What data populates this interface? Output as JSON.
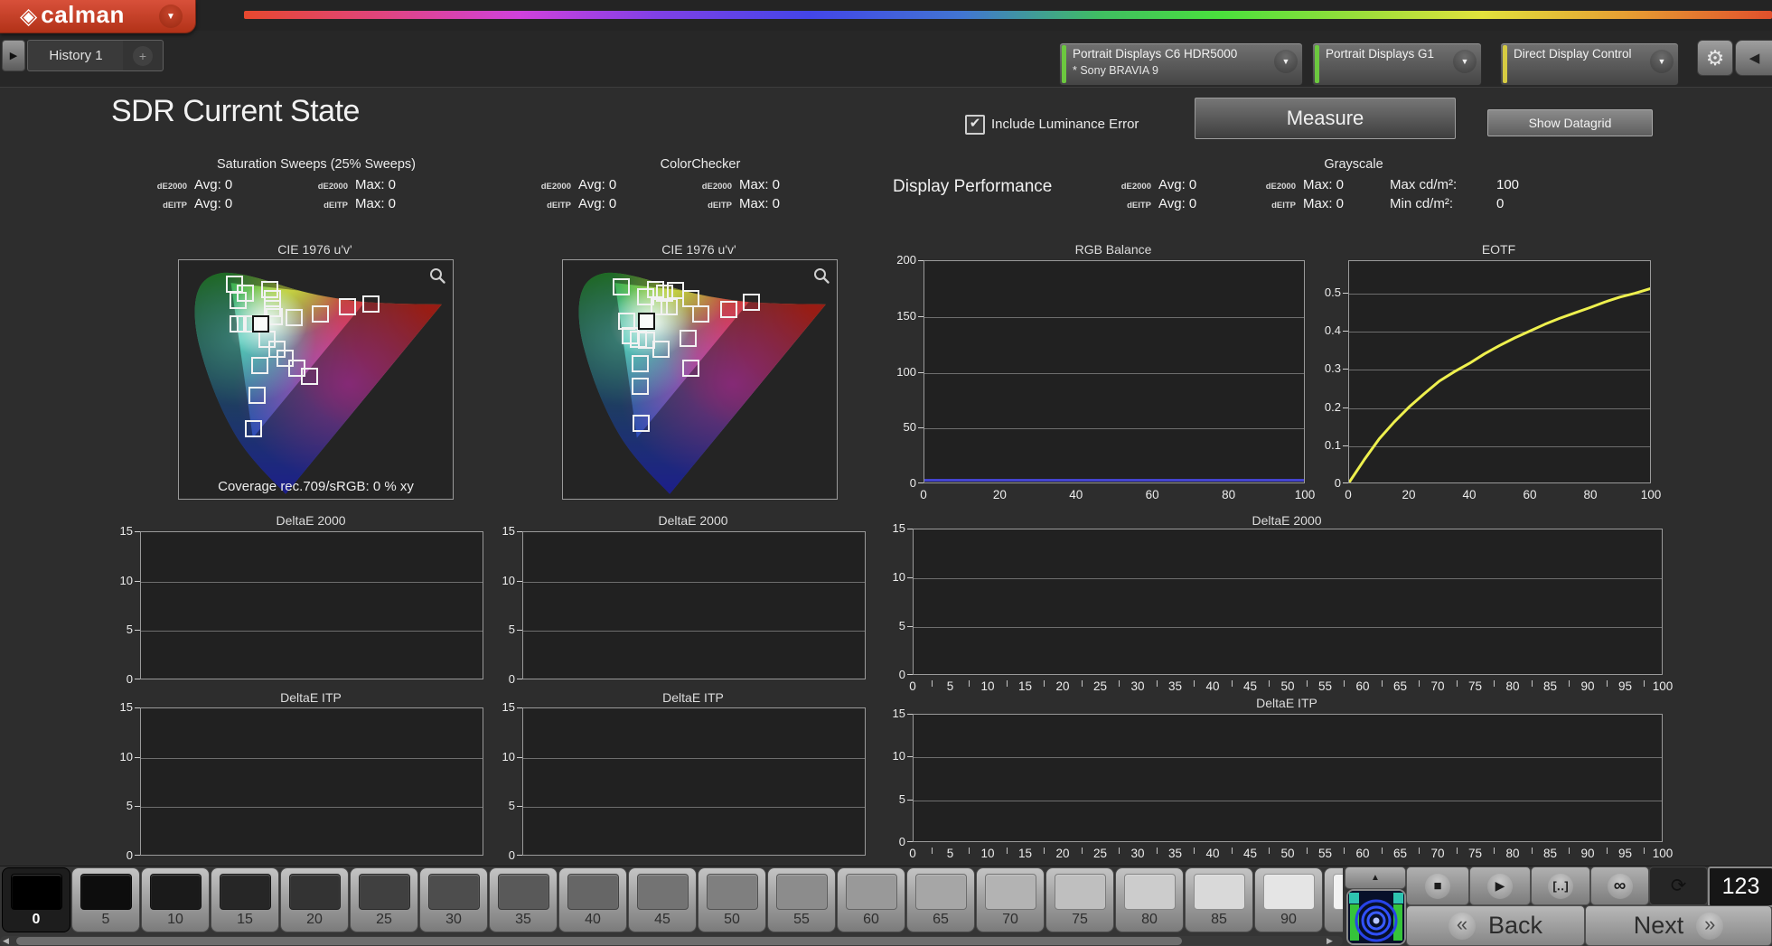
{
  "header": {
    "logo_text": "calman"
  },
  "tabs": {
    "history": "History 1",
    "add": "+"
  },
  "meters": [
    {
      "line1": "Portrait Displays C6 HDR5000",
      "line2": "* Sony BRAVIA 9",
      "stripe": "#6cc83f"
    },
    {
      "line1": "Portrait Displays G1",
      "line2": "",
      "stripe": "#6cc83f"
    },
    {
      "line1": "Direct Display Control",
      "line2": "",
      "stripe": "#d6cb42"
    }
  ],
  "page": {
    "title": "SDR Current State",
    "include_luminance": "Include Luminance Error",
    "measure": "Measure",
    "show_datagrid": "Show Datagrid",
    "display_performance": "Display Performance"
  },
  "stats_groups": [
    {
      "title": "Saturation Sweeps (25% Sweeps)",
      "rows": [
        [
          "dE2000",
          "Avg: 0",
          "dE2000",
          "Max: 0"
        ],
        [
          "dEITP",
          "Avg: 0",
          "dEITP",
          "Max: 0"
        ]
      ]
    },
    {
      "title": "ColorChecker",
      "rows": [
        [
          "dE2000",
          "Avg: 0",
          "dE2000",
          "Max: 0"
        ],
        [
          "dEITP",
          "Avg: 0",
          "dEITP",
          "Max: 0"
        ]
      ]
    },
    {
      "title": "Grayscale",
      "rows": [
        [
          "dE2000",
          "Avg: 0",
          "dE2000",
          "Max: 0",
          "Max cd/m²:",
          "100"
        ],
        [
          "dEITP",
          "Avg: 0",
          "dEITP",
          "Max: 0",
          "Min cd/m²:",
          "0"
        ]
      ]
    }
  ],
  "cie": [
    {
      "title": "CIE 1976 u'v'",
      "coverage": "Coverage rec.709/sRGB:  0 % xy",
      "markers": [
        [
          20,
          10
        ],
        [
          24,
          13.5
        ],
        [
          21.5,
          16.5
        ],
        [
          33,
          12
        ],
        [
          34,
          16
        ],
        [
          34,
          20
        ],
        [
          34.5,
          23.5
        ],
        [
          21.5,
          26.5
        ],
        [
          24,
          26.5
        ],
        [
          26.5,
          26.5
        ],
        [
          42,
          24
        ],
        [
          51.5,
          22.5
        ],
        [
          61.5,
          19.5
        ],
        [
          70,
          18
        ],
        [
          32,
          33
        ],
        [
          35.5,
          37
        ],
        [
          38.5,
          41
        ],
        [
          43,
          45
        ],
        [
          47.5,
          48.5
        ],
        [
          29.5,
          44
        ],
        [
          28.5,
          56.5
        ],
        [
          27,
          70.5
        ]
      ],
      "selected": [
        29.8,
        26.5
      ]
    },
    {
      "title": "CIE 1976 u'v'",
      "coverage": "",
      "markers": [
        [
          21,
          11
        ],
        [
          30,
          15
        ],
        [
          33.5,
          12
        ],
        [
          37,
          13.5
        ],
        [
          41,
          12.5
        ],
        [
          46.5,
          16
        ],
        [
          35,
          19.5
        ],
        [
          38.5,
          19.5
        ],
        [
          50,
          22.5
        ],
        [
          60.5,
          20.5
        ],
        [
          68.5,
          17.5
        ],
        [
          23,
          25.5
        ],
        [
          24.5,
          31.5
        ],
        [
          27.5,
          33
        ],
        [
          30.5,
          33.5
        ],
        [
          35.5,
          37
        ],
        [
          45.5,
          32.5
        ],
        [
          28,
          43
        ],
        [
          46.5,
          45
        ],
        [
          28,
          52.5
        ],
        [
          28.5,
          68
        ]
      ],
      "selected": [
        30.5,
        25.5
      ]
    }
  ],
  "charts": {
    "rgb_balance": {
      "type": "line",
      "title": "RGB Balance",
      "xlim": [
        0,
        100
      ],
      "ylim": [
        0,
        200
      ],
      "x_ticks": [
        0,
        20,
        40,
        60,
        80,
        100
      ],
      "y_ticks": [
        0,
        50,
        100,
        150,
        200
      ],
      "minor_ticks": false,
      "series": [
        {
          "name": "blue",
          "color": "#4444cf",
          "width": 3,
          "points": [
            [
              0,
              2
            ],
            [
              100,
              2
            ]
          ]
        }
      ]
    },
    "eotf": {
      "type": "line",
      "title": "EOTF",
      "xlim": [
        0,
        100
      ],
      "ylim": [
        0,
        0.585
      ],
      "x_ticks": [
        0,
        20,
        40,
        60,
        80,
        100
      ],
      "y_ticks": [
        0,
        0.1,
        0.2,
        0.3,
        0.4,
        0.5
      ],
      "minor_ticks": false,
      "series": [
        {
          "name": "luminance",
          "color": "#eef04e",
          "width": 3,
          "points": [
            [
              0,
              0
            ],
            [
              5,
              0.06
            ],
            [
              10,
              0.115
            ],
            [
              15,
              0.16
            ],
            [
              20,
              0.2
            ],
            [
              25,
              0.235
            ],
            [
              30,
              0.268
            ],
            [
              35,
              0.293
            ],
            [
              40,
              0.315
            ],
            [
              45,
              0.34
            ],
            [
              50,
              0.362
            ],
            [
              55,
              0.382
            ],
            [
              60,
              0.4
            ],
            [
              65,
              0.418
            ],
            [
              70,
              0.434
            ],
            [
              75,
              0.448
            ],
            [
              80,
              0.462
            ],
            [
              85,
              0.477
            ],
            [
              90,
              0.49
            ],
            [
              95,
              0.5
            ],
            [
              100,
              0.512
            ]
          ]
        }
      ]
    },
    "de2000_left": {
      "type": "line",
      "title": "DeltaE 2000",
      "xlim": [
        0,
        100
      ],
      "ylim": [
        0,
        15
      ],
      "x_ticks": [],
      "y_ticks": [
        0,
        5,
        10,
        15
      ],
      "minor_ticks": false,
      "series": []
    },
    "de2000_mid": {
      "type": "line",
      "title": "DeltaE 2000",
      "xlim": [
        0,
        100
      ],
      "ylim": [
        0,
        15
      ],
      "x_ticks": [],
      "y_ticks": [
        0,
        5,
        10,
        15
      ],
      "minor_ticks": false,
      "series": []
    },
    "de2000_big": {
      "type": "line",
      "title": "DeltaE 2000",
      "xlim": [
        0,
        100
      ],
      "ylim": [
        0,
        15
      ],
      "x_ticks": [
        0,
        5,
        10,
        15,
        20,
        25,
        30,
        35,
        40,
        45,
        50,
        55,
        60,
        65,
        70,
        75,
        80,
        85,
        90,
        95,
        100
      ],
      "y_ticks": [
        0,
        5,
        10,
        15
      ],
      "minor_ticks": true,
      "series": []
    },
    "deitp_left": {
      "type": "line",
      "title": "DeltaE ITP",
      "xlim": [
        0,
        100
      ],
      "ylim": [
        0,
        15
      ],
      "x_ticks": [],
      "y_ticks": [
        0,
        5,
        10,
        15
      ],
      "minor_ticks": false,
      "series": []
    },
    "deitp_mid": {
      "type": "line",
      "title": "DeltaE ITP",
      "xlim": [
        0,
        100
      ],
      "ylim": [
        0,
        15
      ],
      "x_ticks": [],
      "y_ticks": [
        0,
        5,
        10,
        15
      ],
      "minor_ticks": false,
      "series": []
    },
    "deitp_big": {
      "type": "line",
      "title": "DeltaE ITP",
      "xlim": [
        0,
        100
      ],
      "ylim": [
        0,
        15
      ],
      "x_ticks": [
        0,
        5,
        10,
        15,
        20,
        25,
        30,
        35,
        40,
        45,
        50,
        55,
        60,
        65,
        70,
        75,
        80,
        85,
        90,
        95,
        100
      ],
      "y_ticks": [
        0,
        5,
        10,
        15
      ],
      "minor_ticks": true,
      "series": []
    }
  },
  "patch_bar": {
    "patches": [
      "0",
      "5",
      "10",
      "15",
      "20",
      "25",
      "30",
      "35",
      "40",
      "45",
      "50",
      "55",
      "60",
      "65",
      "70",
      "75",
      "80",
      "85",
      "90"
    ],
    "counter": "123",
    "back": "Back",
    "next": "Next"
  }
}
